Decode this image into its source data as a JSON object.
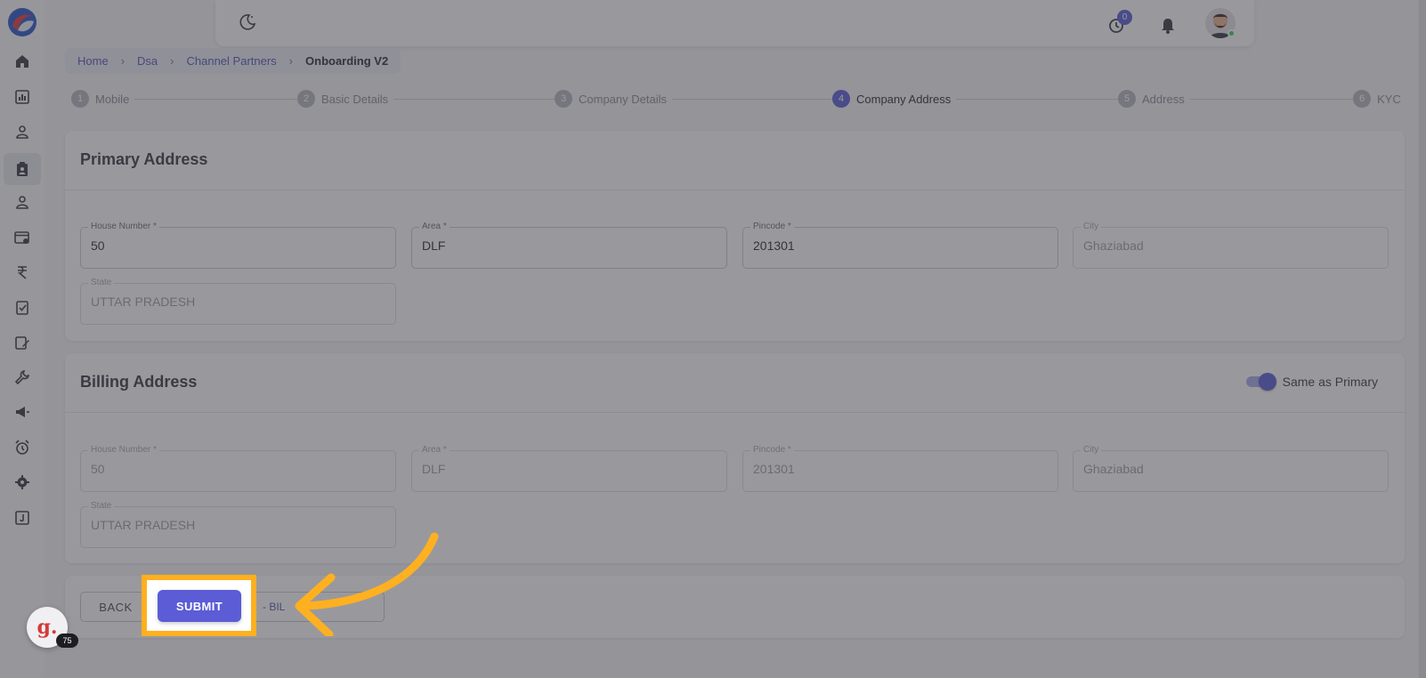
{
  "breadcrumb": {
    "items": [
      "Home",
      "Dsa",
      "Channel Partners"
    ],
    "current": "Onboarding V2"
  },
  "topbar": {
    "timer_badge": "0"
  },
  "stepper": {
    "steps": [
      {
        "num": "1",
        "label": "Mobile"
      },
      {
        "num": "2",
        "label": "Basic Details"
      },
      {
        "num": "3",
        "label": "Company Details"
      },
      {
        "num": "4",
        "label": "Company Address",
        "active": true
      },
      {
        "num": "5",
        "label": "Address"
      },
      {
        "num": "6",
        "label": "KYC"
      }
    ]
  },
  "primary": {
    "title": "Primary Address",
    "house_label": "House Number *",
    "house_value": "50",
    "area_label": "Area *",
    "area_value": "DLF",
    "pincode_label": "Pincode *",
    "pincode_value": "201301",
    "city_label": "City",
    "city_value": "Ghaziabad",
    "state_label": "State",
    "state_value": "UTTAR PRADESH"
  },
  "billing": {
    "title": "Billing Address",
    "toggle_label": "Same as Primary",
    "house_label": "House Number *",
    "house_value": "50",
    "area_label": "Area *",
    "area_value": "DLF",
    "pincode_label": "Pincode *",
    "pincode_value": "201301",
    "city_label": "City",
    "city_value": "Ghaziabad",
    "state_label": "State",
    "state_value": "UTTAR PRADESH"
  },
  "actions": {
    "back_label": "BACK",
    "submit_label": "SUBMIT",
    "billing_label_visible": "- BIL"
  },
  "chat": {
    "letter": "g.",
    "badge": "75"
  },
  "colors": {
    "accent": "#5b5cd6",
    "highlight": "#ffb020",
    "online": "#3ecf5a"
  }
}
